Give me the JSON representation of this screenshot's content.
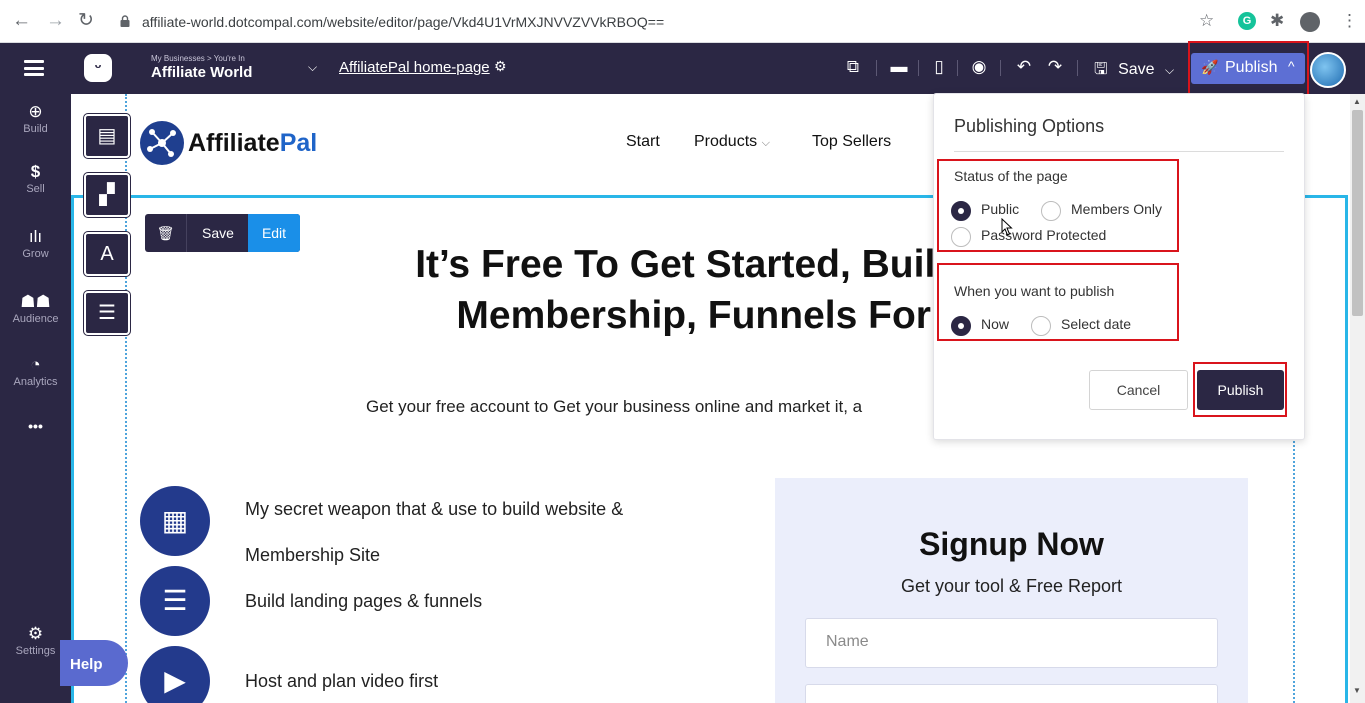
{
  "browser": {
    "url": "affiliate-world.dotcompal.com/website/editor/page/Vkd4U1VrMXJNVVZVVkRBOQ=="
  },
  "topbar": {
    "breadcrumb": "My Businesses > You're In",
    "business_name": "Affiliate World",
    "page_name": "AffiliatePal home-page",
    "save_label": "Save",
    "publish_label": "Publish"
  },
  "sidebar": {
    "items": [
      {
        "label": "Build",
        "icon": "plus-circle-icon"
      },
      {
        "label": "Sell",
        "icon": "dollar-icon"
      },
      {
        "label": "Grow",
        "icon": "bar-chart-icon"
      },
      {
        "label": "Audience",
        "icon": "people-icon"
      },
      {
        "label": "Analytics",
        "icon": "pie-chart-icon"
      }
    ],
    "more": "•••",
    "settings_label": "Settings",
    "help_label": "Help"
  },
  "site": {
    "logo_text_a": "Affiliate",
    "logo_text_b": "Pal",
    "nav": [
      "Start",
      "Products",
      "Top Sellers"
    ],
    "products_chevron": "⌵",
    "edit_bar": {
      "save": "Save",
      "edit": "Edit"
    },
    "hero_line1": "It’s Free To Get Started, Build W",
    "hero_line2": "Membership, Funnels For F",
    "hero_sub": "Get your free account to Get your business online and market it, a",
    "features": [
      "My secret weapon that & use to build website &",
      "Membership Site",
      "Build landing pages & funnels",
      "Host and plan video first"
    ],
    "signup_title": "Signup Now",
    "signup_sub": "Get your tool & Free Report",
    "name_placeholder": "Name"
  },
  "publish_options": {
    "title": "Publishing Options",
    "status_label": "Status of the page",
    "status_options": [
      "Public",
      "Members Only",
      "Password Protected"
    ],
    "status_selected": "Public",
    "when_label": "When you want to publish",
    "when_options": [
      "Now",
      "Select date"
    ],
    "when_selected": "Now",
    "cancel_label": "Cancel",
    "publish_label": "Publish"
  },
  "colors": {
    "editor_dark": "#2b2744",
    "publish_accent": "#5d6fd4",
    "highlight_red": "#d9141c",
    "selection_blue": "#29b6e8"
  }
}
